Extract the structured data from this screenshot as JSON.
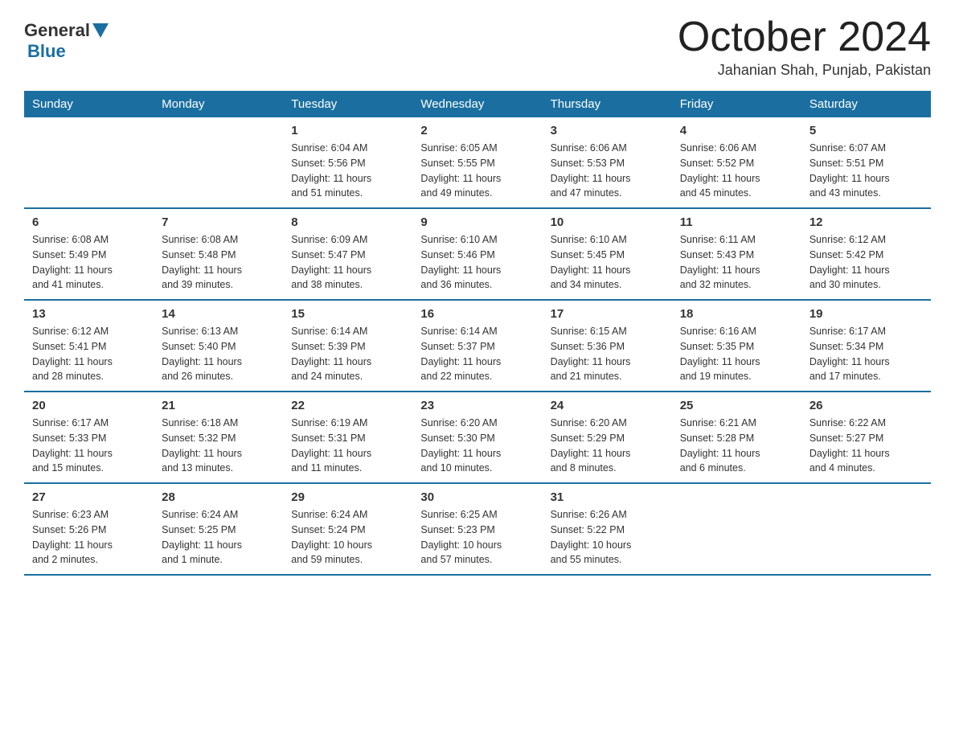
{
  "header": {
    "logo": {
      "general": "General",
      "arrow": "",
      "blue": "Blue"
    },
    "title": "October 2024",
    "location": "Jahanian Shah, Punjab, Pakistan"
  },
  "weekdays": [
    "Sunday",
    "Monday",
    "Tuesday",
    "Wednesday",
    "Thursday",
    "Friday",
    "Saturday"
  ],
  "weeks": [
    [
      {
        "day": "",
        "info": ""
      },
      {
        "day": "",
        "info": ""
      },
      {
        "day": "1",
        "info": "Sunrise: 6:04 AM\nSunset: 5:56 PM\nDaylight: 11 hours\nand 51 minutes."
      },
      {
        "day": "2",
        "info": "Sunrise: 6:05 AM\nSunset: 5:55 PM\nDaylight: 11 hours\nand 49 minutes."
      },
      {
        "day": "3",
        "info": "Sunrise: 6:06 AM\nSunset: 5:53 PM\nDaylight: 11 hours\nand 47 minutes."
      },
      {
        "day": "4",
        "info": "Sunrise: 6:06 AM\nSunset: 5:52 PM\nDaylight: 11 hours\nand 45 minutes."
      },
      {
        "day": "5",
        "info": "Sunrise: 6:07 AM\nSunset: 5:51 PM\nDaylight: 11 hours\nand 43 minutes."
      }
    ],
    [
      {
        "day": "6",
        "info": "Sunrise: 6:08 AM\nSunset: 5:49 PM\nDaylight: 11 hours\nand 41 minutes."
      },
      {
        "day": "7",
        "info": "Sunrise: 6:08 AM\nSunset: 5:48 PM\nDaylight: 11 hours\nand 39 minutes."
      },
      {
        "day": "8",
        "info": "Sunrise: 6:09 AM\nSunset: 5:47 PM\nDaylight: 11 hours\nand 38 minutes."
      },
      {
        "day": "9",
        "info": "Sunrise: 6:10 AM\nSunset: 5:46 PM\nDaylight: 11 hours\nand 36 minutes."
      },
      {
        "day": "10",
        "info": "Sunrise: 6:10 AM\nSunset: 5:45 PM\nDaylight: 11 hours\nand 34 minutes."
      },
      {
        "day": "11",
        "info": "Sunrise: 6:11 AM\nSunset: 5:43 PM\nDaylight: 11 hours\nand 32 minutes."
      },
      {
        "day": "12",
        "info": "Sunrise: 6:12 AM\nSunset: 5:42 PM\nDaylight: 11 hours\nand 30 minutes."
      }
    ],
    [
      {
        "day": "13",
        "info": "Sunrise: 6:12 AM\nSunset: 5:41 PM\nDaylight: 11 hours\nand 28 minutes."
      },
      {
        "day": "14",
        "info": "Sunrise: 6:13 AM\nSunset: 5:40 PM\nDaylight: 11 hours\nand 26 minutes."
      },
      {
        "day": "15",
        "info": "Sunrise: 6:14 AM\nSunset: 5:39 PM\nDaylight: 11 hours\nand 24 minutes."
      },
      {
        "day": "16",
        "info": "Sunrise: 6:14 AM\nSunset: 5:37 PM\nDaylight: 11 hours\nand 22 minutes."
      },
      {
        "day": "17",
        "info": "Sunrise: 6:15 AM\nSunset: 5:36 PM\nDaylight: 11 hours\nand 21 minutes."
      },
      {
        "day": "18",
        "info": "Sunrise: 6:16 AM\nSunset: 5:35 PM\nDaylight: 11 hours\nand 19 minutes."
      },
      {
        "day": "19",
        "info": "Sunrise: 6:17 AM\nSunset: 5:34 PM\nDaylight: 11 hours\nand 17 minutes."
      }
    ],
    [
      {
        "day": "20",
        "info": "Sunrise: 6:17 AM\nSunset: 5:33 PM\nDaylight: 11 hours\nand 15 minutes."
      },
      {
        "day": "21",
        "info": "Sunrise: 6:18 AM\nSunset: 5:32 PM\nDaylight: 11 hours\nand 13 minutes."
      },
      {
        "day": "22",
        "info": "Sunrise: 6:19 AM\nSunset: 5:31 PM\nDaylight: 11 hours\nand 11 minutes."
      },
      {
        "day": "23",
        "info": "Sunrise: 6:20 AM\nSunset: 5:30 PM\nDaylight: 11 hours\nand 10 minutes."
      },
      {
        "day": "24",
        "info": "Sunrise: 6:20 AM\nSunset: 5:29 PM\nDaylight: 11 hours\nand 8 minutes."
      },
      {
        "day": "25",
        "info": "Sunrise: 6:21 AM\nSunset: 5:28 PM\nDaylight: 11 hours\nand 6 minutes."
      },
      {
        "day": "26",
        "info": "Sunrise: 6:22 AM\nSunset: 5:27 PM\nDaylight: 11 hours\nand 4 minutes."
      }
    ],
    [
      {
        "day": "27",
        "info": "Sunrise: 6:23 AM\nSunset: 5:26 PM\nDaylight: 11 hours\nand 2 minutes."
      },
      {
        "day": "28",
        "info": "Sunrise: 6:24 AM\nSunset: 5:25 PM\nDaylight: 11 hours\nand 1 minute."
      },
      {
        "day": "29",
        "info": "Sunrise: 6:24 AM\nSunset: 5:24 PM\nDaylight: 10 hours\nand 59 minutes."
      },
      {
        "day": "30",
        "info": "Sunrise: 6:25 AM\nSunset: 5:23 PM\nDaylight: 10 hours\nand 57 minutes."
      },
      {
        "day": "31",
        "info": "Sunrise: 6:26 AM\nSunset: 5:22 PM\nDaylight: 10 hours\nand 55 minutes."
      },
      {
        "day": "",
        "info": ""
      },
      {
        "day": "",
        "info": ""
      }
    ]
  ]
}
